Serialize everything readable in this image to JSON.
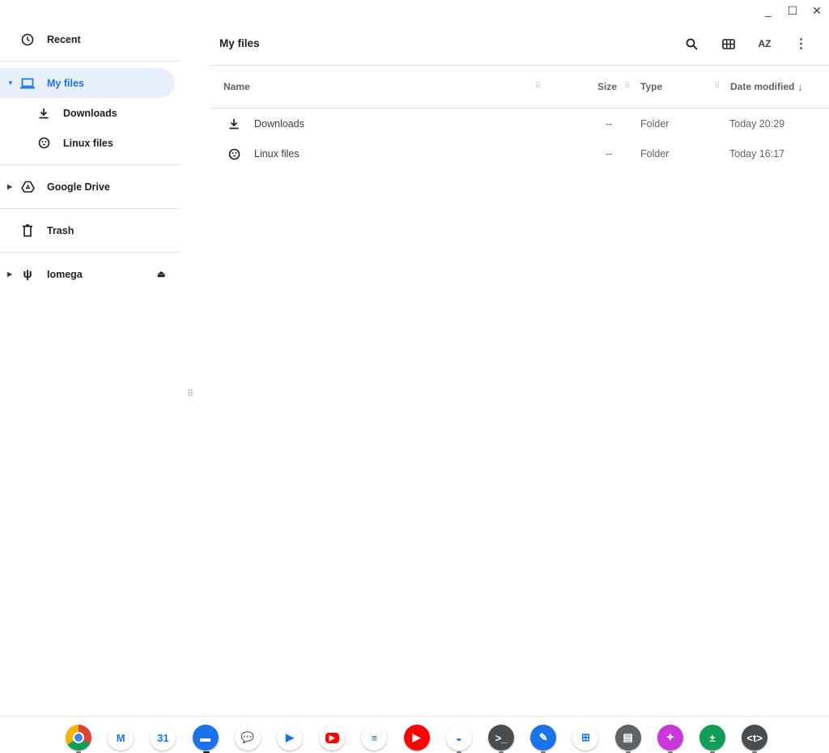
{
  "window": {
    "minimize": "_",
    "maximize": "☐",
    "close": "✕"
  },
  "sidebar": {
    "items": [
      {
        "label": "Recent",
        "icon": "clock-icon"
      },
      {
        "label": "My files",
        "icon": "laptop-icon",
        "selected": true,
        "expanded": true
      },
      {
        "label": "Downloads",
        "icon": "download-icon"
      },
      {
        "label": "Linux files",
        "icon": "penguin-icon"
      },
      {
        "label": "Google Drive",
        "icon": "drive-icon"
      },
      {
        "label": "Trash",
        "icon": "trash-icon"
      },
      {
        "label": "Iomega",
        "icon": "usb-icon"
      }
    ]
  },
  "header": {
    "title": "My files",
    "sort_label": "AZ"
  },
  "table": {
    "columns": [
      "Name",
      "Size",
      "Type",
      "Date modified"
    ],
    "rows": [
      {
        "name": "Downloads",
        "size": "--",
        "type": "Folder",
        "date": "Today 20:29"
      },
      {
        "name": "Linux files",
        "size": "--",
        "type": "Folder",
        "date": "Today 16:17"
      }
    ]
  },
  "shelf": {
    "apps": [
      {
        "name": "Chrome",
        "color": "#4285f4",
        "glyph": ""
      },
      {
        "name": "Gmail",
        "color": "#ffffff",
        "glyph": "M"
      },
      {
        "name": "Calendar",
        "color": "#ffffff",
        "glyph": "31"
      },
      {
        "name": "Files",
        "color": "#1a73e8",
        "glyph": "▬"
      },
      {
        "name": "Messages",
        "color": "#ffffff",
        "glyph": "💬"
      },
      {
        "name": "Meet",
        "color": "#ffffff",
        "glyph": "▶"
      },
      {
        "name": "YouTube",
        "color": "#ffffff",
        "glyph": "▶"
      },
      {
        "name": "Docs",
        "color": "#ffffff",
        "glyph": "≡"
      },
      {
        "name": "YouTube Music",
        "color": "#ff0000",
        "glyph": "▶"
      },
      {
        "name": "Web Store",
        "color": "#ffffff",
        "glyph": "◒"
      },
      {
        "name": "Terminal",
        "color": "#4a4d50",
        "glyph": ">_"
      },
      {
        "name": "Explore",
        "color": "#1a73e8",
        "glyph": "✎"
      },
      {
        "name": "Sheets",
        "color": "#ffffff",
        "glyph": "⊞"
      },
      {
        "name": "Scan",
        "color": "#5f6368",
        "glyph": "▤"
      },
      {
        "name": "Gallery",
        "color": "#c837d8",
        "glyph": "✦"
      },
      {
        "name": "Calculator",
        "color": "#0f9d58",
        "glyph": "±"
      },
      {
        "name": "Text",
        "color": "#4a4d50",
        "glyph": "<t>"
      }
    ]
  }
}
